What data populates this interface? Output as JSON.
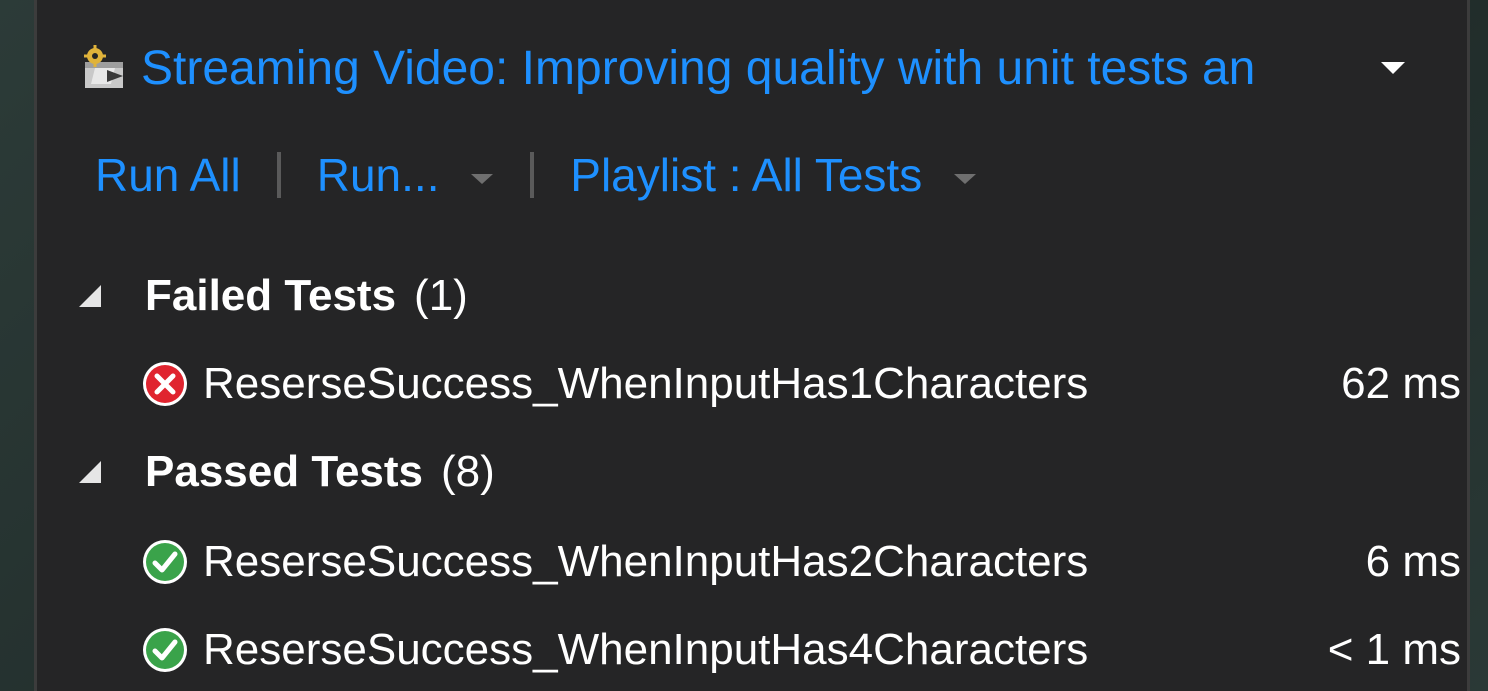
{
  "solution": {
    "title": "Streaming Video: Improving quality with unit tests an",
    "icon": "solution-gear-icon",
    "dropdown_icon": "chevron-down-icon"
  },
  "toolbar": {
    "run_all_label": "Run All",
    "run_label": "Run...",
    "playlist_label": "Playlist : All Tests"
  },
  "groups": {
    "failed": {
      "title": "Failed Tests",
      "count": "(1)",
      "tests": [
        {
          "name": "ReserseSuccess_WhenInputHas1Characters",
          "duration": "62 ms",
          "status": "failed"
        }
      ]
    },
    "passed": {
      "title": "Passed Tests",
      "count": "(8)",
      "tests": [
        {
          "name": "ReserseSuccess_WhenInputHas2Characters",
          "duration": "6 ms",
          "status": "passed"
        },
        {
          "name": "ReserseSuccess_WhenInputHas4Characters",
          "duration": "< 1 ms",
          "status": "passed"
        }
      ]
    }
  },
  "colors": {
    "link": "#1e90ff",
    "failed": "#e0242f",
    "passed": "#3aa34a",
    "panel_bg": "#252526"
  }
}
